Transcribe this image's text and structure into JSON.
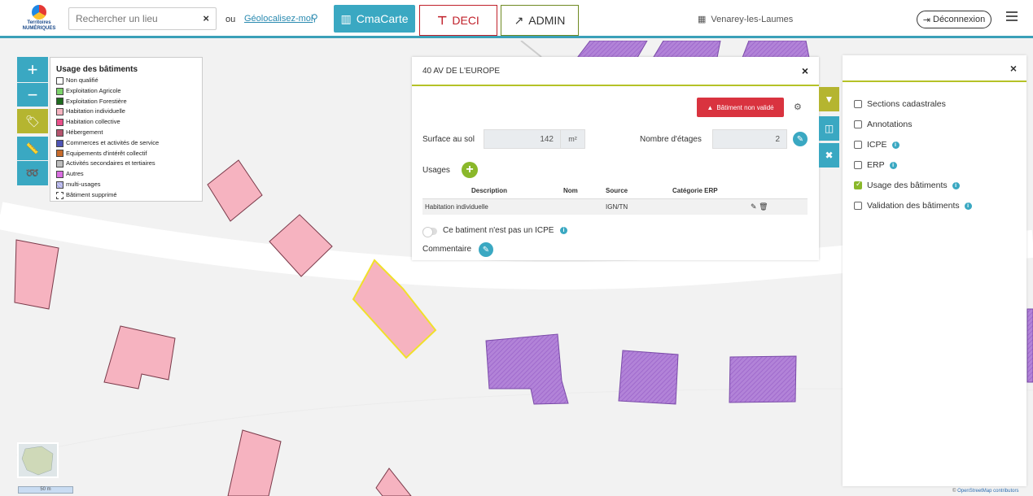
{
  "app": {
    "logo_text": "Territoires NUMÉRIQUES",
    "search_placeholder": "Rechercher un lieu",
    "search_clear": "×",
    "or_label": "ou",
    "geolocate_label": "Géolocalisez-moi",
    "btn_cma": "CmaCarte",
    "btn_deci": "DECI",
    "btn_admin": "ADMIN",
    "commune": "Venarey-les-Laumes",
    "logout_label": "Déconnexion"
  },
  "legend": {
    "title": "Usage des bâtiments",
    "items": [
      {
        "label": "Non qualifié",
        "color": "#ffffff"
      },
      {
        "label": "Exploitation Agricole",
        "color": "#7dd36b"
      },
      {
        "label": "Exploitation Forestière",
        "color": "#1f6b1f"
      },
      {
        "label": "Habitation individuelle",
        "color": "#f6b3c0"
      },
      {
        "label": "Habitation collective",
        "color": "#e8508a"
      },
      {
        "label": "Hébergement",
        "color": "#b5546e"
      },
      {
        "label": "Commerces et activités de service",
        "color": "#4e54b5"
      },
      {
        "label": "Equipements d'intérêt collectif",
        "color": "#c76b2b"
      },
      {
        "label": "Activités secondaires et tertiaires",
        "color": "#bdbdbd"
      },
      {
        "label": "Autres",
        "color": "#d96ee0"
      },
      {
        "label": "multi-usages",
        "color": "#c7c7f0"
      },
      {
        "label": "Bâtiment supprimé",
        "color": "#ffffff"
      }
    ]
  },
  "popup": {
    "address": "40 AV DE L'EUROPE",
    "close": "×",
    "status_badge": "Bâtiment non validé",
    "surface_label": "Surface au sol",
    "surface_value": "142",
    "surface_unit": "m²",
    "floors_label": "Nombre d'étages",
    "floors_value": "2",
    "usages_label": "Usages",
    "table_headers": [
      "Description",
      "Nom",
      "Source",
      "Catégorie ERP"
    ],
    "table_rows": [
      {
        "description": "Habitation individuelle",
        "nom": "",
        "source": "IGN/TN",
        "categorie": ""
      }
    ],
    "icpe_toggle_label": "Ce batiment n'est pas un ICPE",
    "comment_label": "Commentaire"
  },
  "layers": {
    "close": "×",
    "items": [
      {
        "label": "Sections cadastrales",
        "checked": false,
        "info": false
      },
      {
        "label": "Annotations",
        "checked": false,
        "info": false
      },
      {
        "label": "ICPE",
        "checked": false,
        "info": true
      },
      {
        "label": "ERP",
        "checked": false,
        "info": true
      },
      {
        "label": "Usage des bâtiments",
        "checked": true,
        "info": true
      },
      {
        "label": "Validation des bâtiments",
        "checked": false,
        "info": true
      }
    ]
  },
  "map": {
    "scale_label": "50 m",
    "attribution_link": "OpenStreetMap",
    "attribution_text": " contributors",
    "colors": {
      "accent": "#3aa8c2",
      "habitation": "#f6b3c0",
      "commerce_hatch": "#b07ad6",
      "selected_outline": "#f0e02a",
      "deci": "#c0202a",
      "admin": "#6f8a22"
    }
  }
}
